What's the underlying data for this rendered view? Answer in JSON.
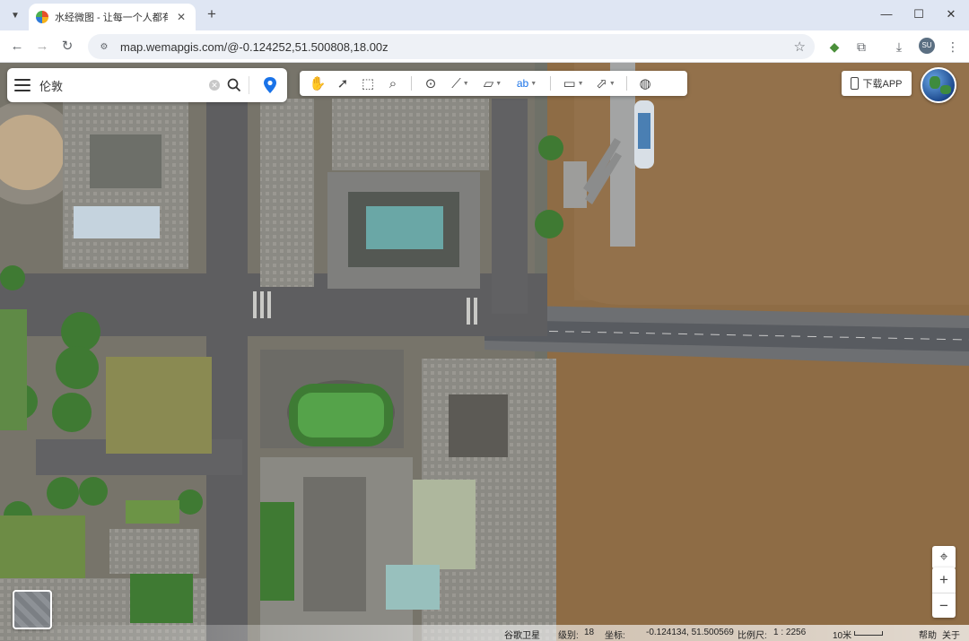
{
  "browser": {
    "tab_title": "水经微图 - 让每一个人都有自己",
    "url": "map.wemapgis.com/@-0.124252,51.500808,18.00z",
    "profile_initials": "SU"
  },
  "map": {
    "search": {
      "value": "伦敦"
    },
    "download_app_label": "下载APP",
    "status": {
      "source": "谷歌卫星",
      "level_label": "级别:",
      "level_value": "18",
      "coord_label": "坐标:",
      "coord_value": "-0.124134, 51.500569",
      "scale_label": "比例尺:",
      "scale_value": "1 : 2256",
      "scale_distance": "10米",
      "help": "帮助",
      "about": "关于"
    }
  },
  "colors": {
    "accent": "#1a73e8",
    "river": "#8e6c45",
    "building": "#8a8a86"
  },
  "icons": [
    "hamburger-icon",
    "clear-icon",
    "search-icon",
    "location-pin-icon",
    "pan-hand-icon",
    "pointer-icon",
    "select-icon",
    "zoom-search-icon",
    "marker-icon",
    "polyline-icon",
    "polygon-icon",
    "text-label-icon",
    "measure-icon",
    "cursor-info-icon",
    "globe-icon",
    "locate-icon"
  ]
}
